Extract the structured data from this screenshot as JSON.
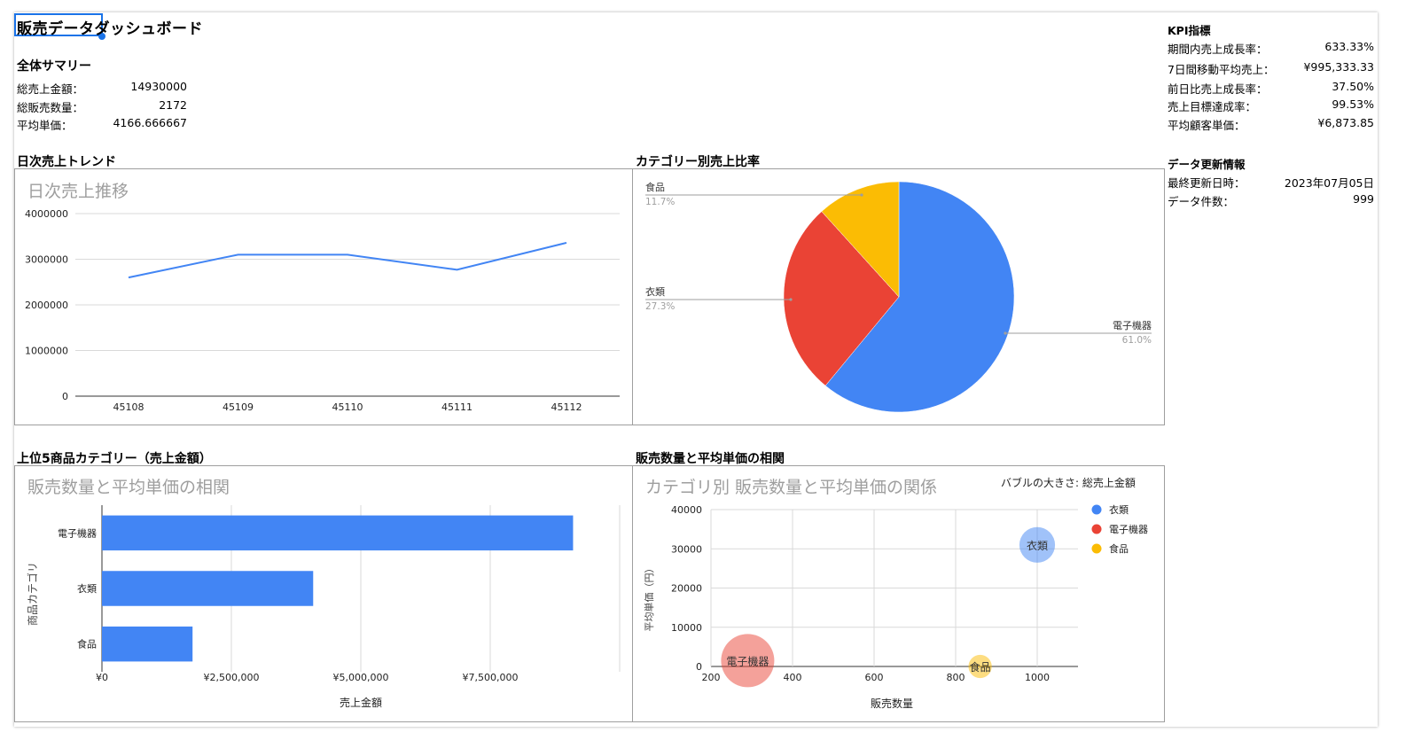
{
  "title": "販売データダッシュボード",
  "summary": {
    "heading": "全体サマリー",
    "rows": [
      {
        "label": "総売上金額：",
        "value": "14930000"
      },
      {
        "label": "総販売数量：",
        "value": "2172"
      },
      {
        "label": "平均単価：",
        "value": "4166.666667"
      }
    ]
  },
  "kpi": {
    "heading": "KPI指標",
    "rows": [
      {
        "label": "期間内売上成長率：",
        "value": "633.33%"
      },
      {
        "label": "7日間移動平均売上：",
        "value": "¥995,333.33"
      },
      {
        "label": "前日比売上成長率：",
        "value": "37.50%"
      },
      {
        "label": "売上目標達成率：",
        "value": "99.53%"
      },
      {
        "label": "平均顧客単価：",
        "value": "¥6,873.85"
      }
    ]
  },
  "update": {
    "heading": "データ更新情報",
    "rows": [
      {
        "label": "最終更新日時：",
        "value": "2023年07月05日"
      },
      {
        "label": "データ件数：",
        "value": "999"
      }
    ]
  },
  "sections": {
    "trend": "日次売上トレンド",
    "category": "カテゴリー別売上比率",
    "top5": "上位5商品カテゴリー（売上金額）",
    "corr": "販売数量と平均単価の相関"
  },
  "colors": {
    "blue": "#4285f4",
    "red": "#ea4335",
    "yellow": "#fbbc04",
    "grid": "#d9d9d9",
    "axis": "#333333"
  },
  "chart_data": [
    {
      "id": "line",
      "type": "line",
      "title": "日次売上推移",
      "x": [
        "45108",
        "45109",
        "45110",
        "45111",
        "45112"
      ],
      "series": [
        {
          "values": [
            2600000,
            3100000,
            3100000,
            2770000,
            3360000
          ]
        }
      ],
      "yticks": [
        "0",
        "1000000",
        "2000000",
        "3000000",
        "4000000"
      ],
      "ylim": [
        0,
        4000000
      ],
      "grid": true
    },
    {
      "id": "pie",
      "type": "pie",
      "slices": [
        {
          "label": "電子機器",
          "pct": "61.0%",
          "value": 61.0
        },
        {
          "label": "衣類",
          "pct": "27.3%",
          "value": 27.3
        },
        {
          "label": "食品",
          "pct": "11.7%",
          "value": 11.7
        }
      ]
    },
    {
      "id": "bar",
      "type": "bar",
      "title": "販売数量と平均単価の相関",
      "categories": [
        "電子機器",
        "衣類",
        "食品"
      ],
      "values": [
        9100000,
        4080000,
        1750000
      ],
      "xticks": [
        "¥0",
        "¥2,500,000",
        "¥5,000,000",
        "¥7,500,000"
      ],
      "xlim": [
        0,
        10000000
      ],
      "xlabel": "売上金額",
      "ylabel": "商品カテゴリ",
      "grid": true
    },
    {
      "id": "bubble",
      "type": "scatter",
      "title": "カテゴリ別 販売数量と平均単価の関係",
      "note": "バブルの大きさ: 総売上金額",
      "xlabel": "販売数量",
      "ylabel": "平均単価（円）",
      "xticks": [
        "200",
        "400",
        "600",
        "800",
        "1000"
      ],
      "yticks": [
        "0",
        "10000",
        "20000",
        "30000",
        "40000"
      ],
      "xlim": [
        200,
        1100
      ],
      "ylim": [
        0,
        40000
      ],
      "points": [
        {
          "name": "衣類",
          "x": 1000,
          "y": 31000,
          "size": 4080000,
          "color": "#4285f4"
        },
        {
          "name": "電子機器",
          "x": 290,
          "y": 1500,
          "size": 9100000,
          "color": "#ea4335"
        },
        {
          "name": "食品",
          "x": 860,
          "y": 0,
          "size": 1750000,
          "color": "#fbbc04"
        }
      ],
      "legend": [
        {
          "name": "衣類",
          "color": "#4285f4"
        },
        {
          "name": "電子機器",
          "color": "#ea4335"
        },
        {
          "name": "食品",
          "color": "#fbbc04"
        }
      ],
      "legend_position": "top-right",
      "grid": true
    }
  ]
}
